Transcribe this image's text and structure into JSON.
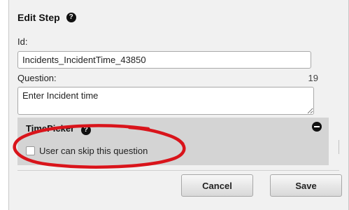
{
  "dialog": {
    "title": "Edit Step",
    "help_icon": "question-circle-icon"
  },
  "id_field": {
    "label": "Id:",
    "value": "Incidents_IncidentTime_43850"
  },
  "question_field": {
    "label": "Question:",
    "char_count": "19",
    "value": "Enter Incident time"
  },
  "timepicker_panel": {
    "title": "TimePicker",
    "help_icon": "question-circle-icon",
    "collapse_icon": "minus-circle-icon",
    "skip_checkbox": {
      "label": "User can skip this question",
      "checked": false
    }
  },
  "annotation": {
    "shape": "hand-drawn ellipse",
    "color": "#d9141b"
  },
  "buttons": {
    "cancel_label": "Cancel",
    "save_label": "Save"
  },
  "colors": {
    "dialog_background": "#f1f1f1",
    "panel_background": "#d4d4d4",
    "annotation_red": "#d9141b"
  }
}
